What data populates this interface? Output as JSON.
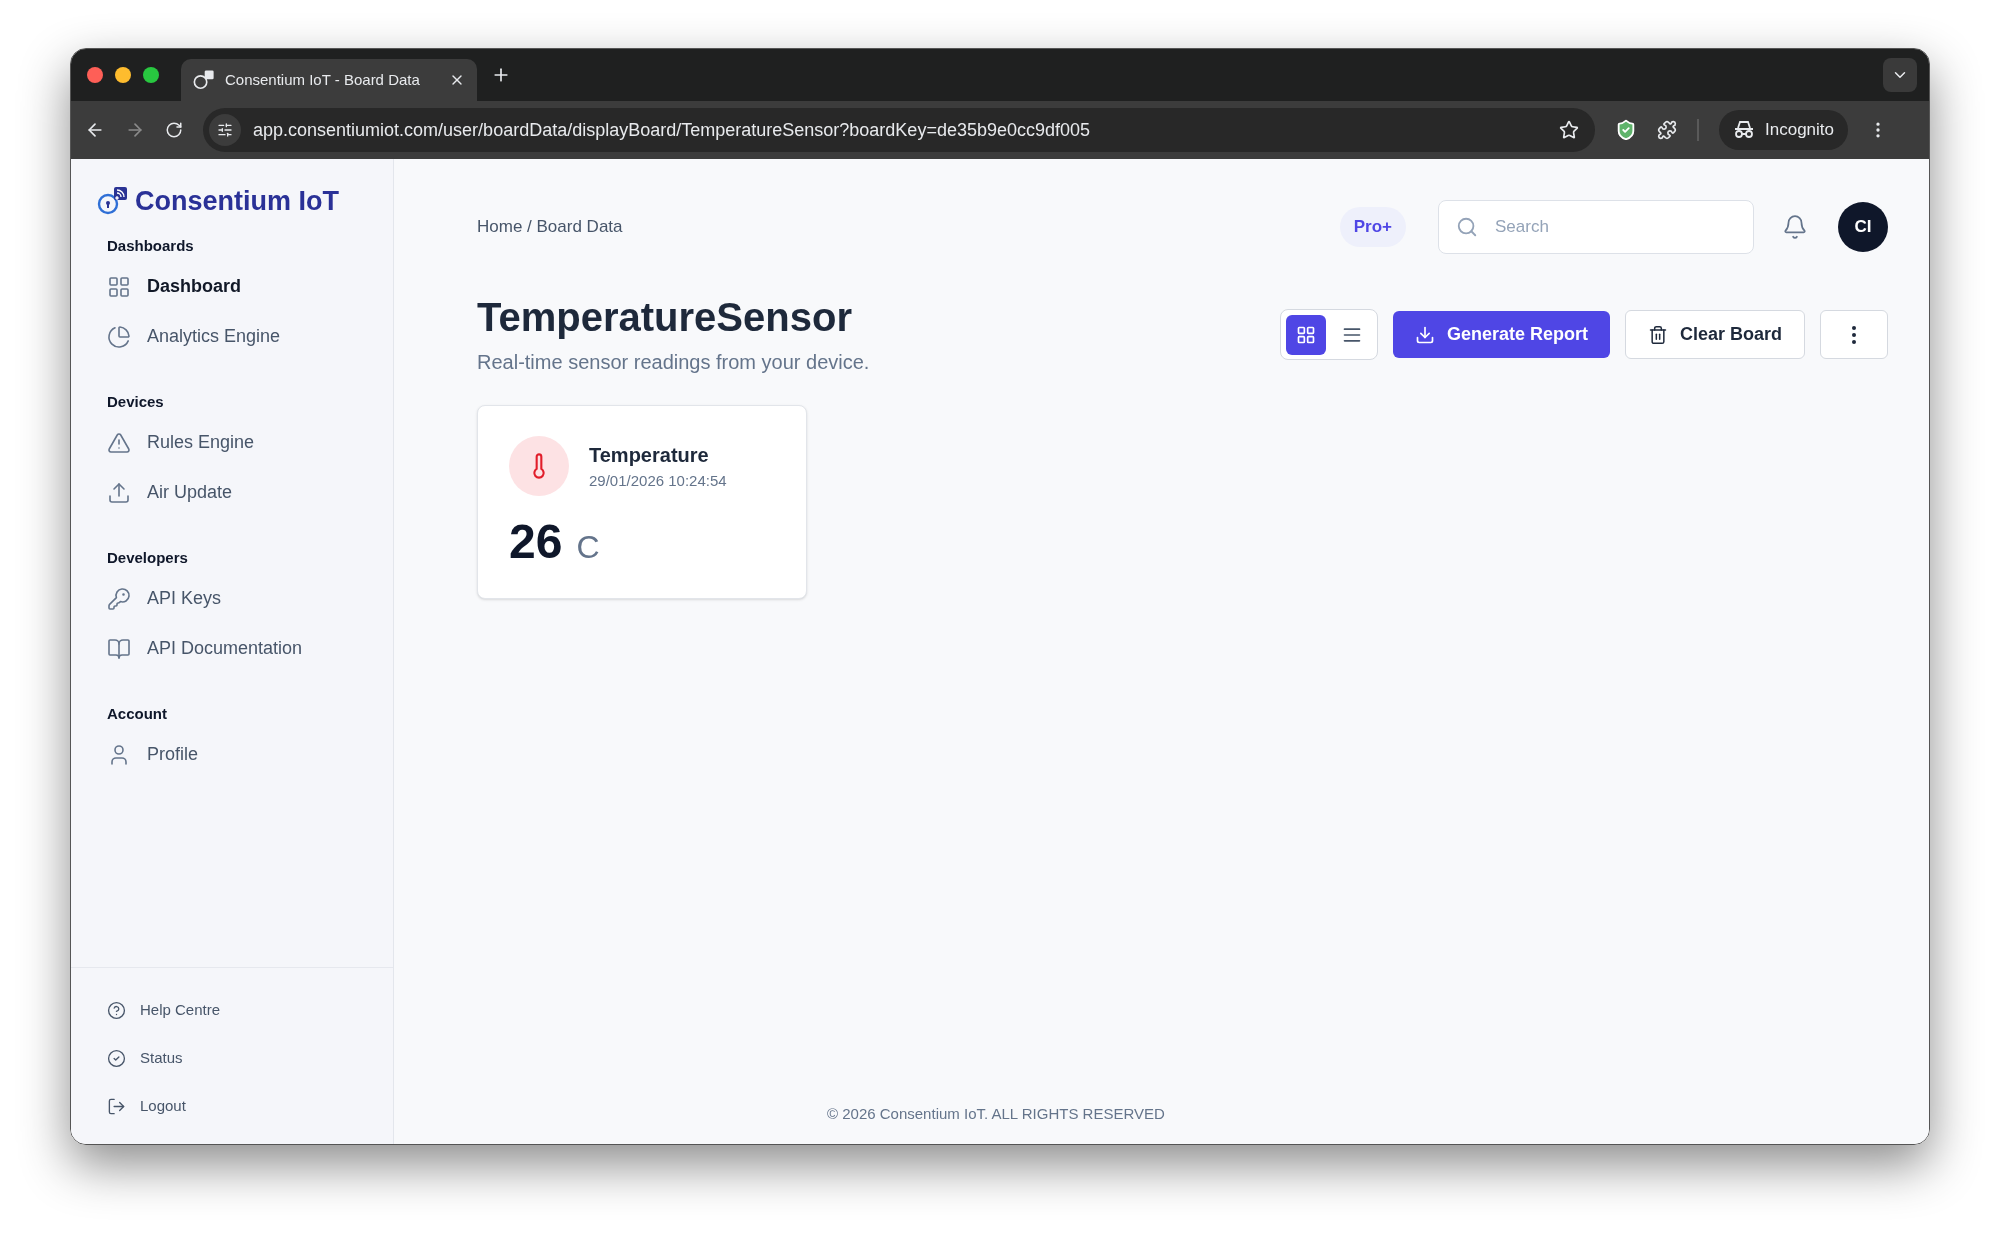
{
  "browser": {
    "tab_title": "Consentium IoT - Board Data",
    "url": "app.consentiumiot.com/user/boardData/displayBoard/TemperatureSensor?boardKey=de35b9e0cc9df005",
    "profile_label": "Incognito"
  },
  "sidebar": {
    "brand": "Consentium IoT",
    "sections": [
      {
        "heading": "Dashboards",
        "items": [
          {
            "label": "Dashboard",
            "selected": true
          },
          {
            "label": "Analytics Engine",
            "selected": false
          }
        ]
      },
      {
        "heading": "Devices",
        "items": [
          {
            "label": "Rules Engine",
            "selected": false
          },
          {
            "label": "Air Update",
            "selected": false
          }
        ]
      },
      {
        "heading": "Developers",
        "items": [
          {
            "label": "API Keys",
            "selected": false
          },
          {
            "label": "API Documentation",
            "selected": false
          }
        ]
      },
      {
        "heading": "Account",
        "items": [
          {
            "label": "Profile",
            "selected": false
          }
        ]
      }
    ],
    "footer_items": [
      "Help Centre",
      "Status",
      "Logout"
    ]
  },
  "header": {
    "breadcrumb": "Home / Board Data",
    "plan_badge": "Pro+",
    "search": {
      "placeholder": "Search"
    },
    "avatar": "CI"
  },
  "page": {
    "title": "TemperatureSensor",
    "subtitle": "Real-time sensor readings from your device.",
    "view_modes": [
      {
        "kind": "grid",
        "selected": true
      },
      {
        "kind": "list",
        "selected": false
      }
    ],
    "actions": [
      {
        "kind": "primary",
        "label": "Generate Report"
      },
      {
        "kind": "secondary",
        "label": "Clear Board"
      },
      {
        "kind": "menu"
      }
    ]
  },
  "readings": [
    {
      "name": "Temperature",
      "timestamp": "29/01/2026 10:24:54",
      "value": "26",
      "unit": "C"
    }
  ],
  "footer": "© 2026 Consentium IoT. ALL RIGHTS RESERVED"
}
